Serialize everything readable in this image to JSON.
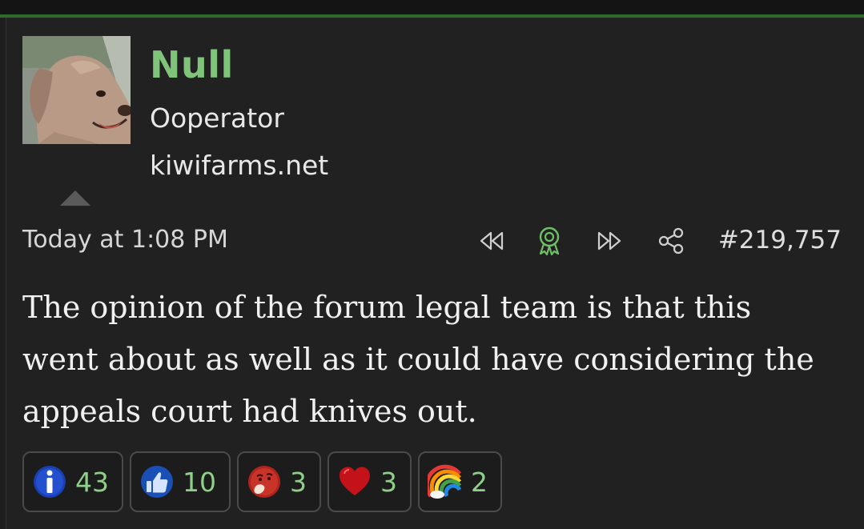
{
  "colors": {
    "accent_bar": "#2f6a2a",
    "username": "#7fc47a",
    "reaction_count": "#8fcf8a",
    "background": "#212121"
  },
  "user": {
    "name": "Null",
    "title": "Ooperator",
    "banner": "kiwifarms.net",
    "avatar_icon": "dog-avatar"
  },
  "post": {
    "date": "Today at 1:08 PM",
    "number": "#219,757",
    "actions": [
      "previous-post-icon",
      "award-icon",
      "next-post-icon",
      "share-icon"
    ],
    "message": "The opinion of the forum legal team is that this went about as well as it could have considering the appeals court had knives out."
  },
  "reactions": [
    {
      "icon": "informative-icon",
      "count": "43"
    },
    {
      "icon": "thumbs-up-icon",
      "count": "10"
    },
    {
      "icon": "thinking-icon",
      "count": "3"
    },
    {
      "icon": "heart-icon",
      "count": "3"
    },
    {
      "icon": "rainbow-icon",
      "count": "2"
    }
  ]
}
